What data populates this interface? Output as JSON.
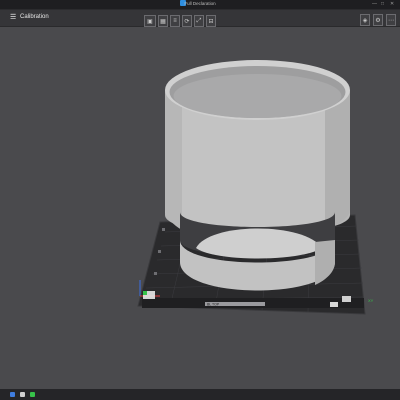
{
  "window": {
    "title": "Full Declaration"
  },
  "toolbar": {
    "project_name": "Calibration"
  },
  "bed": {
    "label": "BL TOP"
  },
  "colors": {
    "titlebar": "#1e1e21",
    "toolbar": "#353538",
    "viewport": "#4a4a4d",
    "bed": "#2a2a2c",
    "model": "#c8c8c8",
    "axis_x": "#e23b3b",
    "axis_y": "#37c24a",
    "axis_z": "#3b6fe2"
  },
  "icons": {
    "menu": "menu-icon",
    "tools": [
      "cube-icon",
      "grid-icon",
      "layers-icon",
      "rotate-icon",
      "scale-icon",
      "split-icon"
    ],
    "right": [
      "view-icon",
      "settings-icon",
      "more-icon"
    ]
  }
}
